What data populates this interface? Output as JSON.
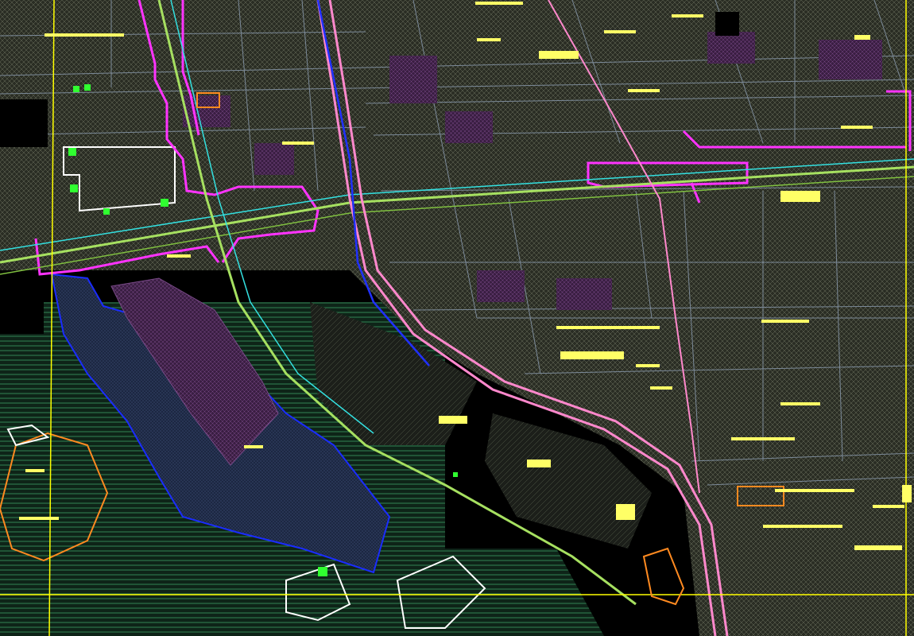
{
  "viewport": {
    "description_labels": []
  },
  "colors": {
    "background": "#000000",
    "grid_lines": "#7c8a99",
    "road_magenta": "#ff33ff",
    "road_pink": "#ff88cc",
    "road_green": "#a6e060",
    "road_cyan": "#33e0e0",
    "road_blue": "#2030ff",
    "road_yellow": "#ffff00",
    "water_fill": "#1c2742",
    "water_edge": "#1a2cff",
    "purple_fill": "#3a1e42",
    "green_hatch": "#3fae6e",
    "block_fill": "#2e3228",
    "orange": "#ff8a20",
    "label_text": "#ffff66"
  },
  "icons": {
    "site_marker": "green-square-marker-icon"
  }
}
